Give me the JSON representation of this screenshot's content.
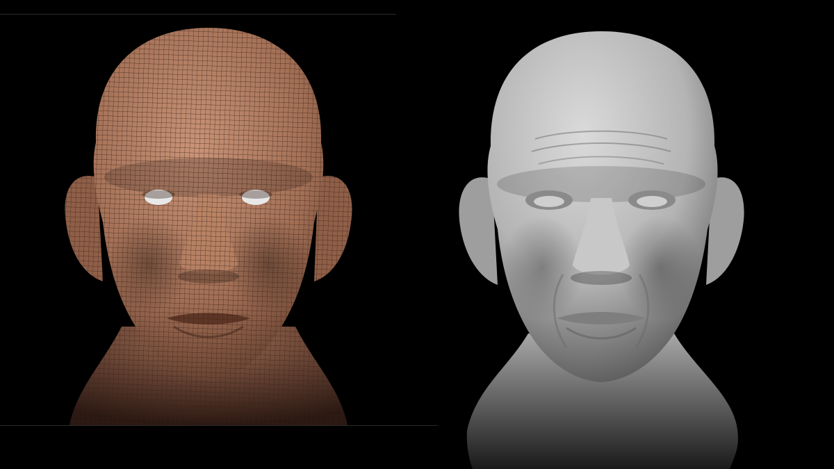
{
  "panels": [
    {
      "id": "wireframe-view",
      "render_style": "wireframe-quad-mesh",
      "subject": "elderly-male-head-sculpt",
      "base_color": "#b27d62",
      "wire_color": "#3a2016",
      "eye_color": "#e8e8e8"
    },
    {
      "id": "clay-view",
      "render_style": "smooth-clay",
      "subject": "elderly-male-head-sculpt",
      "base_color": "#bdbdbd",
      "shadow_color": "#2e2e2e"
    }
  ],
  "colors": {
    "background": "#000000",
    "viewport_line": "#2a2a2a"
  }
}
